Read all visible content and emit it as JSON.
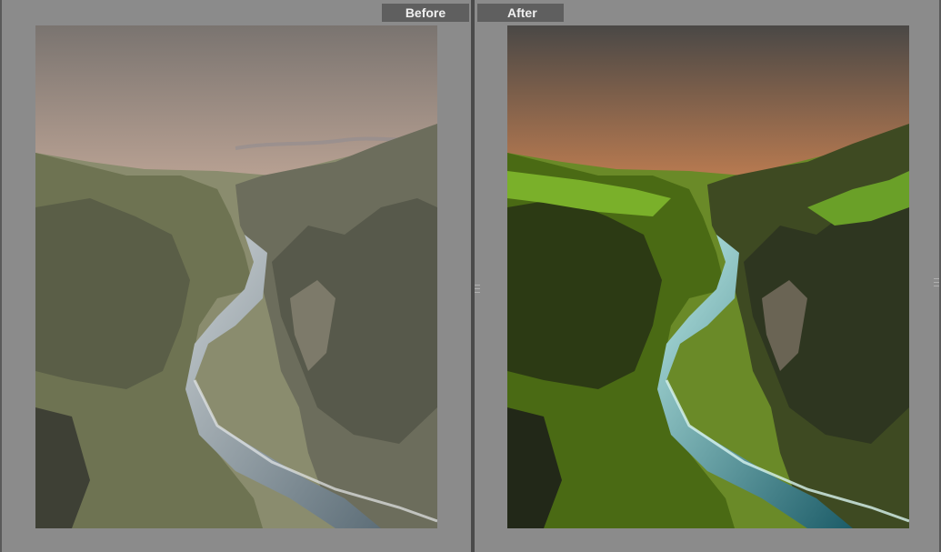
{
  "labels": {
    "before": "Before",
    "after": "After"
  },
  "icons": {
    "left_handle": "drag-handle-icon",
    "right_handle": "drag-handle-icon"
  },
  "colors": {
    "background": "#8b8b8b",
    "tab_background": "#5f5f5f",
    "tab_text": "#f0f0f0",
    "divider": "#4a4a4a"
  }
}
